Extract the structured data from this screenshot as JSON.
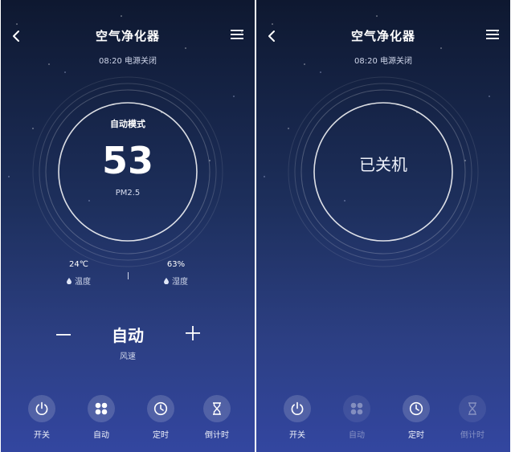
{
  "colors": {
    "bg_top": "#0e1830",
    "bg_bottom": "#3346a0",
    "text": "#ffffff",
    "muted_text": "#cfd6ea",
    "button_bg": "rgba(255,255,255,0.16)"
  },
  "screens": [
    {
      "state": "on",
      "header": {
        "title": "空气净化器",
        "subtitle": "08:20 电源关闭",
        "back_icon": "chevron-left-icon",
        "menu_icon": "menu-icon"
      },
      "dial": {
        "mode": "自动模式",
        "value": "53",
        "unit": "PM2.5"
      },
      "stats": {
        "temperature": {
          "value": "24℃",
          "label": "温度",
          "icon": "drop-icon"
        },
        "humidity": {
          "value": "63%",
          "label": "湿度",
          "icon": "drop-icon"
        }
      },
      "fan": {
        "value": "自动",
        "label": "风速"
      },
      "controls": [
        {
          "label": "开关",
          "icon": "power-icon",
          "enabled": true
        },
        {
          "label": "自动",
          "icon": "grid-icon",
          "enabled": true
        },
        {
          "label": "定时",
          "icon": "clock-icon",
          "enabled": true
        },
        {
          "label": "倒计时",
          "icon": "hourglass-icon",
          "enabled": true
        }
      ]
    },
    {
      "state": "off",
      "header": {
        "title": "空气净化器",
        "subtitle": "08:20 电源关闭",
        "back_icon": "chevron-left-icon",
        "menu_icon": "menu-icon"
      },
      "dial": {
        "status": "已关机"
      },
      "controls": [
        {
          "label": "开关",
          "icon": "power-icon",
          "enabled": true
        },
        {
          "label": "自动",
          "icon": "grid-icon",
          "enabled": false
        },
        {
          "label": "定时",
          "icon": "clock-icon",
          "enabled": true
        },
        {
          "label": "倒计时",
          "icon": "hourglass-icon",
          "enabled": false
        }
      ]
    }
  ]
}
